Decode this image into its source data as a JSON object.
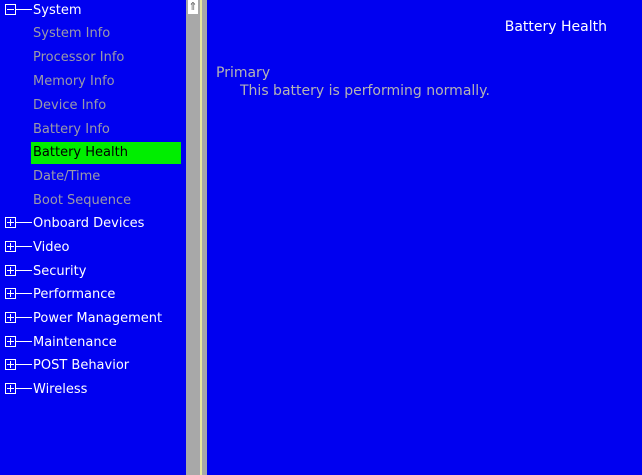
{
  "nav": {
    "system": {
      "label": "System",
      "children": [
        "System Info",
        "Processor Info",
        "Memory Info",
        "Device Info",
        "Battery Info",
        "Battery Health",
        "Date/Time",
        "Boot Sequence"
      ]
    },
    "groups": [
      "Onboard Devices",
      "Video",
      "Security",
      "Performance",
      "Power Management",
      "Maintenance",
      "POST Behavior",
      "Wireless"
    ]
  },
  "scrollbar": {
    "up_glyph": "⇑"
  },
  "content": {
    "title": "Battery Health",
    "section": "Primary",
    "message": "This battery is performing normally."
  },
  "colors": {
    "background": "#0000f0",
    "selection": "#00ee00",
    "muted_text": "#9a9aa8",
    "text": "#ffffff"
  }
}
